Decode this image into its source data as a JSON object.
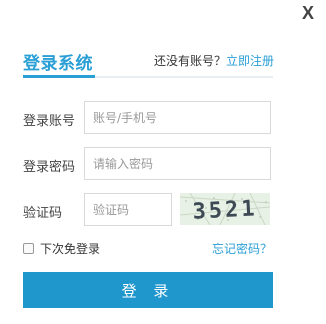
{
  "close_label": "X",
  "title": "登录系统",
  "register": {
    "prompt": "还没有账号？",
    "link": "立即注册"
  },
  "fields": {
    "account": {
      "label": "登录账号",
      "placeholder": "账号/手机号",
      "value": ""
    },
    "password": {
      "label": "登录密码",
      "placeholder": "请输入密码",
      "value": ""
    },
    "captcha": {
      "label": "验证码",
      "placeholder": "验证码",
      "value": "",
      "image_text": "3521"
    }
  },
  "remember_label": "下次免登录",
  "forgot_label": "忘记密码？",
  "login_button": "登 录",
  "colors": {
    "accent": "#2a9fd6",
    "button": "#1f97cc"
  }
}
